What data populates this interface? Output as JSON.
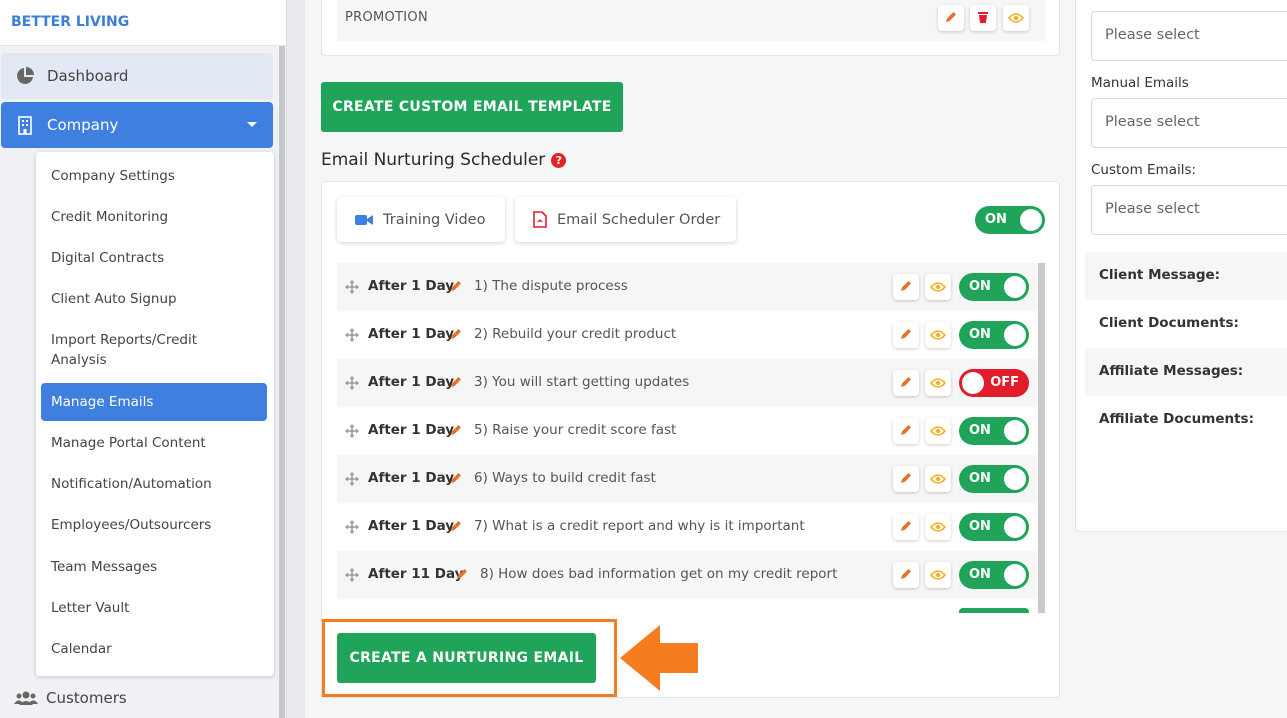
{
  "brand": "BETTER LIVING",
  "sidebar": {
    "dashboard": "Dashboard",
    "company": "Company",
    "customers": "Customers",
    "submenu": [
      "Company Settings",
      "Credit Monitoring",
      "Digital Contracts",
      "Client Auto Signup",
      "Import Reports/Credit Analysis",
      "Manage Emails",
      "Manage Portal Content",
      "Notification/Automation",
      "Employees/Outsourcers",
      "Team Messages",
      "Letter Vault",
      "Calendar"
    ],
    "active_item": "Manage Emails"
  },
  "templates": {
    "last_row_label": "PROMOTION",
    "create_template_button": "CREATE CUSTOM EMAIL TEMPLATE"
  },
  "scheduler": {
    "title": "Email Nurturing Scheduler",
    "help": "?",
    "training_video": "Training Video",
    "scheduler_order": "Email Scheduler Order",
    "master_toggle": "ON",
    "rows": [
      {
        "delay": "After 1 Day",
        "title": "1) The dispute process",
        "status": "ON"
      },
      {
        "delay": "After 1 Day",
        "title": "2) Rebuild your credit product",
        "status": "ON"
      },
      {
        "delay": "After 1 Day",
        "title": "3) You will start getting updates",
        "status": "OFF"
      },
      {
        "delay": "After 1 Day",
        "title": "5) Raise your credit score fast",
        "status": "ON"
      },
      {
        "delay": "After 1 Day",
        "title": "6) Ways to build credit fast",
        "status": "ON"
      },
      {
        "delay": "After 1 Day",
        "title": "7) What is a credit report and why is it important",
        "status": "ON"
      },
      {
        "delay": "After 11 Day",
        "title": "8) How does bad information get on my credit report",
        "status": "ON"
      }
    ],
    "create_button": "CREATE A NURTURING EMAIL"
  },
  "right_panel": {
    "manual_label": "Manual Emails",
    "custom_label": "Custom Emails:",
    "placeholder": "Please select",
    "info": [
      "Client Message:",
      "Client Documents:",
      "Affiliate Messages:",
      "Affiliate Documents:"
    ]
  },
  "colors": {
    "primary": "#3f7fe0",
    "success": "#1fa45a",
    "danger": "#e21d2b",
    "accent": "#f57c1f"
  }
}
